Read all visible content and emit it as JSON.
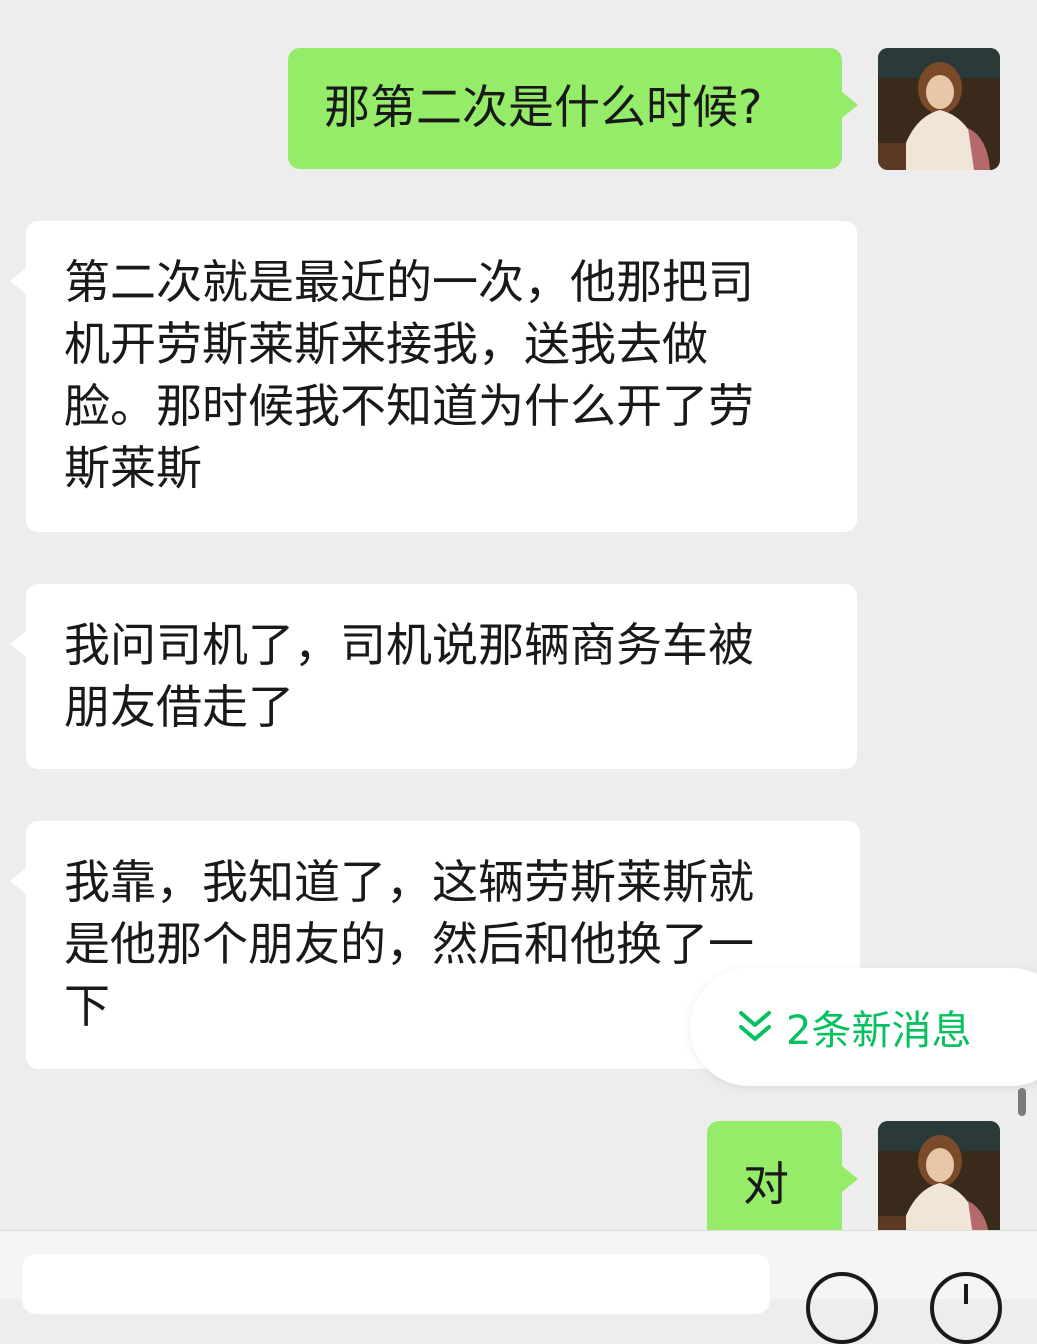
{
  "messages": [
    {
      "side": "sent",
      "text": "那第二次是什么时候?"
    },
    {
      "side": "received",
      "lines": [
        "第二次就是最近的一次，他那把司",
        "机开劳斯莱斯来接我，送我去做",
        "脸。那时候我不知道为什么开了劳",
        "斯莱斯"
      ]
    },
    {
      "side": "received",
      "lines": [
        "我问司机了，司机说那辆商务车被",
        "朋友借走了"
      ]
    },
    {
      "side": "received",
      "lines": [
        "我靠，我知道了，这辆劳斯莱斯就",
        "是他那个朋友的，然后和他换了一",
        "下"
      ]
    },
    {
      "side": "sent",
      "text": "对"
    }
  ],
  "new_messages_indicator": {
    "label": "2条新消息",
    "icon": "double-chevron-down-icon"
  },
  "avatar": {
    "icon": "profile-avatar-painting"
  },
  "input_bar": {
    "placeholder": "",
    "voice_button_icon": "emoji-icon",
    "more_button_icon": "plus-icon"
  },
  "colors": {
    "sent_bubble": "#95ec69",
    "received_bubble": "#ffffff",
    "background": "#ededed",
    "accent": "#07c160"
  }
}
